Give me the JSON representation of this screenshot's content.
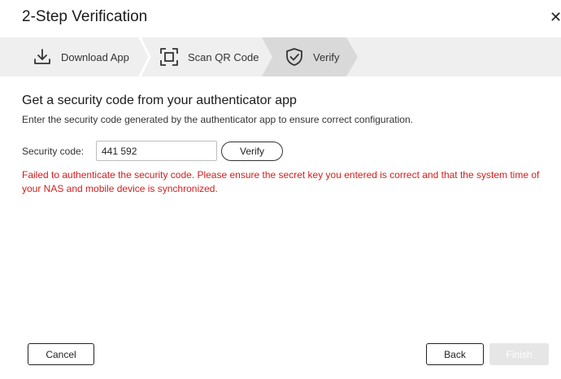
{
  "dialog": {
    "title": "2-Step Verification",
    "close_glyph": "✕"
  },
  "steps": [
    {
      "label": "Download App",
      "icon": "download-icon",
      "state": "done"
    },
    {
      "label": "Scan QR Code",
      "icon": "qr-scan-icon",
      "state": "done"
    },
    {
      "label": "Verify",
      "icon": "shield-check-icon",
      "state": "active"
    }
  ],
  "content": {
    "heading": "Get a security code from your authenticator app",
    "description": "Enter the security code generated by the authenticator app to ensure correct configuration.",
    "code_label": "Security code:",
    "code_value": "441 592",
    "verify_label": "Verify",
    "error": "Failed to authenticate the security code. Please ensure the secret key you entered is correct and that the system time of your NAS and mobile device is synchronized."
  },
  "footer": {
    "cancel_label": "Cancel",
    "back_label": "Back",
    "finish_label": "Finish"
  },
  "colors": {
    "error": "#d31d1d",
    "stepbar": "#efefef",
    "active_step": "#d9d9d9",
    "finish_disabled": "#e6e6e6"
  }
}
